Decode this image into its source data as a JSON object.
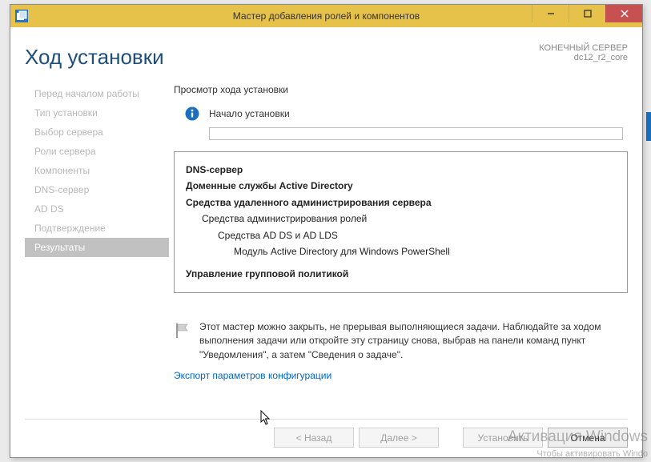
{
  "window": {
    "title": "Мастер добавления ролей и компонентов"
  },
  "header": {
    "title": "Ход установки",
    "dest_label": "КОНЕЧНЫЙ СЕРВЕР",
    "dest_name": "dc12_r2_core"
  },
  "sidebar": {
    "items": [
      "Перед началом работы",
      "Тип установки",
      "Выбор сервера",
      "Роли сервера",
      "Компоненты",
      "DNS-сервер",
      "AD DS",
      "Подтверждение",
      "Результаты"
    ]
  },
  "main": {
    "progress_label": "Просмотр хода установки",
    "status_text": "Начало установки",
    "details": [
      "DNS-сервер",
      "Доменные службы Active Directory",
      "Средства удаленного администрирования сервера",
      "Средства администрирования ролей",
      "Средства AD DS и AD LDS",
      "Модуль Active Directory для Windows PowerShell",
      "Управление групповой политикой"
    ],
    "note": "Этот мастер можно закрыть, не прерывая выполняющиеся задачи. Наблюдайте за ходом выполнения задачи или откройте эту страницу снова, выбрав на панели команд пункт \"Уведомления\", а затем \"Сведения о задаче\".",
    "export_link": "Экспорт параметров конфигурации"
  },
  "footer": {
    "back": "< Назад",
    "next": "Далее >",
    "install": "Установить",
    "cancel": "Отмена"
  },
  "watermark": {
    "line1": "Активация Windows",
    "line2": "Чтобы активировать Windo"
  }
}
